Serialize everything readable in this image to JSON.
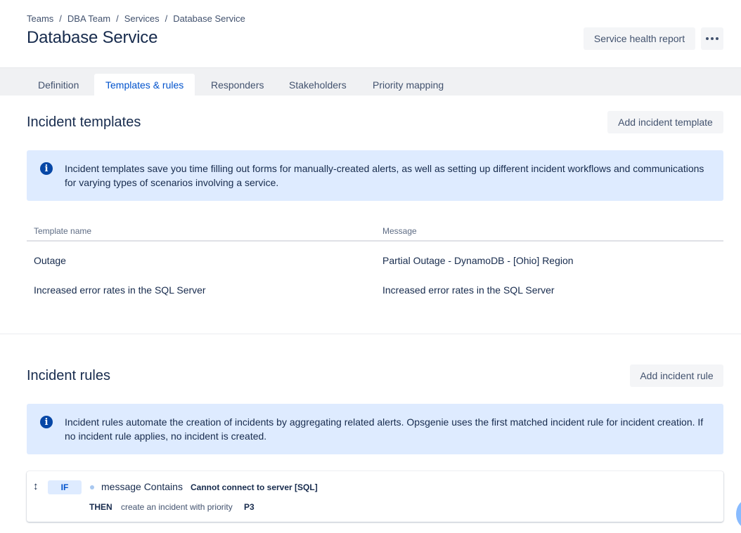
{
  "breadcrumb": [
    "Teams",
    "DBA Team",
    "Services",
    "Database Service"
  ],
  "page_title": "Database Service",
  "header_actions": {
    "health_report_label": "Service health report",
    "more_icon": "more-horizontal-icon"
  },
  "tabs": [
    {
      "label": "Definition",
      "active": false
    },
    {
      "label": "Templates & rules",
      "active": true
    },
    {
      "label": "Responders",
      "active": false
    },
    {
      "label": "Stakeholders",
      "active": false
    },
    {
      "label": "Priority mapping",
      "active": false
    }
  ],
  "incident_templates": {
    "title": "Incident templates",
    "add_button": "Add incident template",
    "info_text": "Incident templates save you time filling out forms for manually-created alerts, as well as setting up different incident workflows and communications for varying types of scenarios involving a service.",
    "columns": [
      "Template name",
      "Message"
    ],
    "rows": [
      [
        "Outage",
        "Partial Outage - DynamoDB - [Ohio] Region"
      ],
      [
        "Increased error rates in the SQL Server",
        "Increased error rates in the SQL Server"
      ]
    ]
  },
  "incident_rules": {
    "title": "Incident rules",
    "add_button": "Add incident rule",
    "info_text": "Incident rules automate the creation of incidents by aggregating related alerts. Opsgenie uses the first matched incident rule for incident creation. If no incident rule applies, no incident is created.",
    "rule": {
      "if_label": "IF",
      "condition_field": "message Contains",
      "condition_value": "Cannot connect to server [SQL]",
      "then_label": "THEN",
      "then_text": "create an incident with priority",
      "priority": "P3"
    }
  },
  "colors": {
    "info_bg": "#deebff",
    "info_icon": "#0747a6",
    "active_tab": "#0052cc",
    "text": "#172b4d",
    "subtle_text": "#42526e",
    "button_bg": "#f4f5f7"
  }
}
